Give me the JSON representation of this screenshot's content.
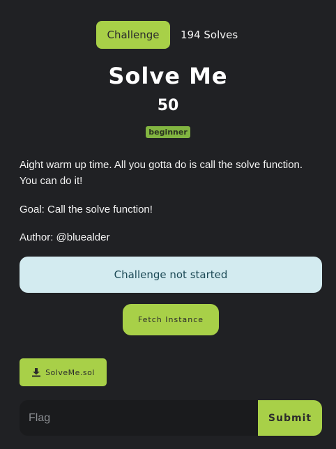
{
  "tabs": {
    "active_label": "Challenge",
    "solves_label": "194 Solves"
  },
  "challenge": {
    "title": "Solve Me",
    "points": "50",
    "tag": "beginner",
    "description": "Aight warm up time. All you gotta do is call the solve function. You can do it!",
    "goal": "Goal: Call the solve function!",
    "author": "Author: @bluealder"
  },
  "instance": {
    "status": "Challenge not started",
    "fetch_label": "Fetch Instance"
  },
  "files": {
    "download_label": "SolveMe.sol",
    "download_icon": "download-icon"
  },
  "flag_form": {
    "value": "",
    "placeholder": "Flag",
    "submit_label": "Submit"
  },
  "colors": {
    "background": "#202124",
    "accent": "#a8d048",
    "tag": "#82b541",
    "status_bg": "#d3ebf0",
    "status_text": "#1c4a56"
  }
}
